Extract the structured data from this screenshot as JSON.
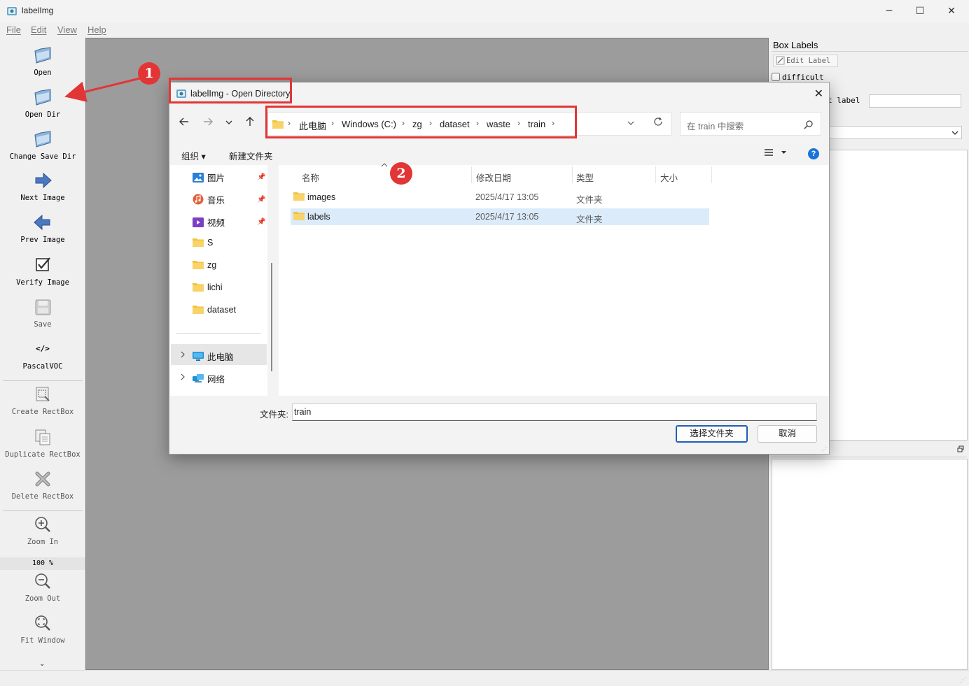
{
  "window": {
    "title": "labelImg",
    "minimize": "─",
    "maximize": "☐",
    "close": "✕"
  },
  "menu": [
    "File",
    "Edit",
    "View",
    "Help"
  ],
  "toolbar": {
    "open": "Open",
    "open_dir": "Open Dir",
    "change_save_dir": "Change Save Dir",
    "next_image": "Next Image",
    "prev_image": "Prev Image",
    "verify_image": "Verify Image",
    "save": "Save",
    "format_icon": "</>",
    "format": "PascalVOC",
    "create_rectbox": "Create RectBox",
    "duplicate_rectbox": "Duplicate RectBox",
    "delete_rectbox": "Delete RectBox",
    "zoom_in": "Zoom In",
    "zoom_level": "100 %",
    "zoom_out": "Zoom Out",
    "fit_window": "Fit Window",
    "more": "⌄"
  },
  "right_panel": {
    "box_labels_title": "Box Labels",
    "edit_label": "Edit Label",
    "difficult": "difficult",
    "use_default_label": "t label"
  },
  "annotations": {
    "marker_1": "1",
    "marker_2": "2",
    "color": "#e23636"
  },
  "dialog": {
    "title": "labelImg - Open Directory",
    "close": "✕",
    "breadcrumbs": [
      "此电脑",
      "Windows (C:)",
      "zg",
      "dataset",
      "waste",
      "train"
    ],
    "search_placeholder": "在 train 中搜索",
    "organize": "组织 ▾",
    "new_folder": "新建文件夹",
    "help": "?",
    "nav_items": [
      {
        "label": "图片",
        "icon": "pictures-icon",
        "pinned": true
      },
      {
        "label": "音乐",
        "icon": "music-icon",
        "pinned": true
      },
      {
        "label": "视频",
        "icon": "videos-icon",
        "pinned": true
      },
      {
        "label": "S",
        "icon": "folder-icon",
        "pinned": false
      },
      {
        "label": "zg",
        "icon": "folder-icon",
        "pinned": false
      },
      {
        "label": "lichi",
        "icon": "folder-icon",
        "pinned": false
      },
      {
        "label": "dataset",
        "icon": "folder-icon",
        "pinned": false
      }
    ],
    "nav_tree": [
      {
        "label": "此电脑",
        "icon": "computer-icon",
        "selected": true
      },
      {
        "label": "网络",
        "icon": "network-icon",
        "selected": false
      }
    ],
    "columns": [
      "名称",
      "修改日期",
      "类型",
      "大小"
    ],
    "files": [
      {
        "name": "images",
        "modified": "2025/4/17 13:05",
        "type": "文件夹",
        "selected": false
      },
      {
        "name": "labels",
        "modified": "2025/4/17 13:05",
        "type": "文件夹",
        "selected": true
      }
    ],
    "folder_field_label": "文件夹:",
    "folder_field_value": "train",
    "select_folder_button": "选择文件夹",
    "cancel_button": "取消"
  }
}
